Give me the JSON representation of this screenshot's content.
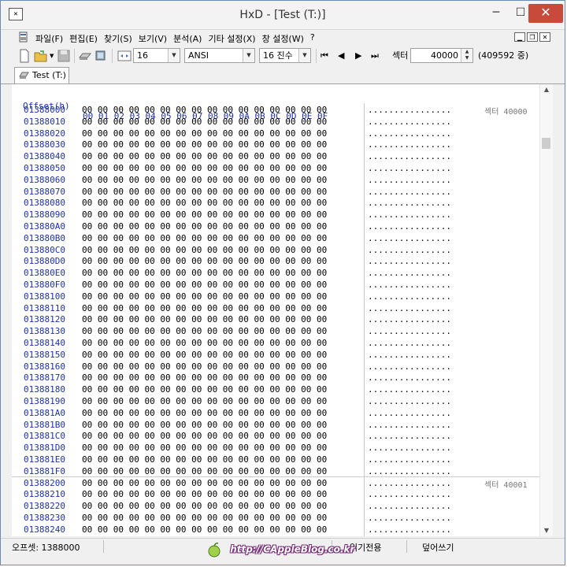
{
  "window": {
    "title": "HxD - [Test (T:)]",
    "min_glyph": "─",
    "max_glyph": "☐",
    "close_glyph": "✕"
  },
  "menu": {
    "items": [
      "파일(F)",
      "편집(E)",
      "찾기(S)",
      "보기(V)",
      "분석(A)",
      "기타 설정(X)",
      "창 설정(W)",
      "?"
    ]
  },
  "toolbar": {
    "bytes_per_row": "16",
    "charset": "ANSI",
    "base": "16 진수",
    "sector_label": "섹터",
    "sector_value": "40000",
    "sector_total": "(409592 중)"
  },
  "tabs": [
    {
      "label": "Test (T:)"
    }
  ],
  "editor": {
    "offset_header": "Offset(h)",
    "column_header": "00 01 02 03 04 05 06 07 08 09 0A 0B 0C 0D 0E 0F",
    "hex_zero_row": "00 00 00 00 00 00 00 00 00 00 00 00 00 00 00 00",
    "text_zero_row": "................",
    "sector_markers": [
      {
        "row": 0,
        "label": "섹터 40000"
      },
      {
        "row": 32,
        "label": "섹터 40001"
      }
    ],
    "offsets": [
      "01388000",
      "01388010",
      "01388020",
      "01388030",
      "01388040",
      "01388050",
      "01388060",
      "01388070",
      "01388080",
      "01388090",
      "013880A0",
      "013880B0",
      "013880C0",
      "013880D0",
      "013880E0",
      "013880F0",
      "01388100",
      "01388110",
      "01388120",
      "01388130",
      "01388140",
      "01388150",
      "01388160",
      "01388170",
      "01388180",
      "01388190",
      "013881A0",
      "013881B0",
      "013881C0",
      "013881D0",
      "013881E0",
      "013881F0",
      "01388200",
      "01388210",
      "01388220",
      "01388230",
      "01388240"
    ]
  },
  "status": {
    "offset": "오프셋: 1388000",
    "readonly": "읽기전용",
    "overwrite": "덮어쓰기"
  },
  "watermark": {
    "text": "http://CAppleBlog.co.kr"
  },
  "colors": {
    "offset_blue": "#1c2fb5",
    "close_red": "#c74a3a"
  }
}
